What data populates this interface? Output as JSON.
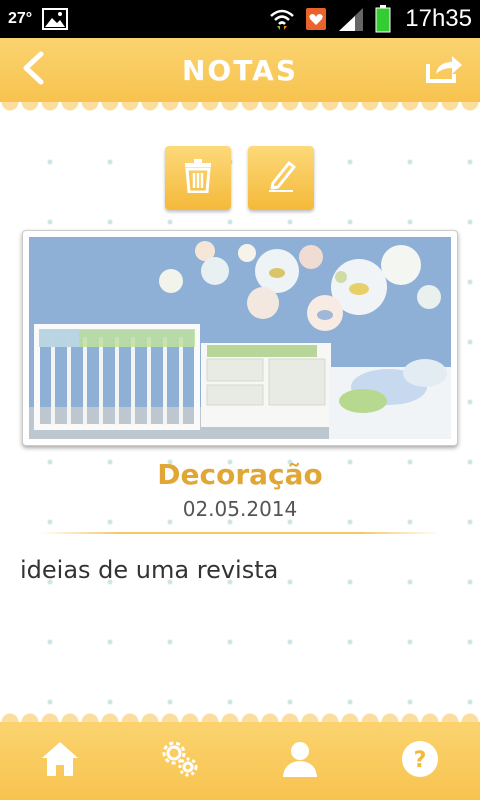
{
  "status_bar": {
    "temperature": "27°",
    "time": "17h35",
    "icons": [
      "gallery-icon",
      "wifi-icon",
      "notification-icon",
      "signal-icon",
      "battery-icon"
    ]
  },
  "header": {
    "title": "NOTAS",
    "back_icon": "chevron-left-icon",
    "share_icon": "share-icon"
  },
  "actions": {
    "delete_icon": "trash-icon",
    "edit_icon": "pencil-icon"
  },
  "note": {
    "title": "Decoração",
    "date": "02.05.2014",
    "body": "ideias de uma revista",
    "image_description": "nursery-room-photo"
  },
  "bottom_nav": {
    "items": [
      {
        "icon": "home-icon"
      },
      {
        "icon": "settings-icon"
      },
      {
        "icon": "profile-icon"
      },
      {
        "icon": "help-icon"
      }
    ]
  },
  "colors": {
    "accent": "#f7c34f",
    "title_text": "#e0a737",
    "header_text": "#ffffff"
  }
}
